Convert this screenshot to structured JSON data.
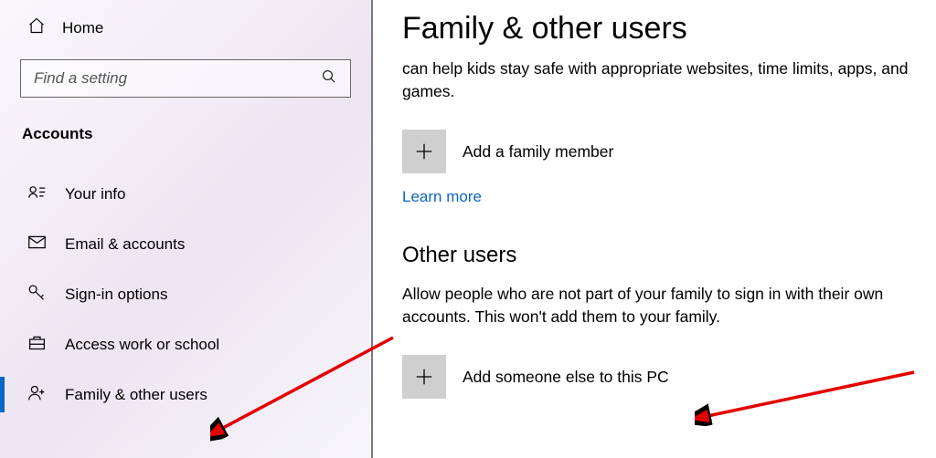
{
  "sidebar": {
    "home_label": "Home",
    "search_placeholder": "Find a setting",
    "section_label": "Accounts",
    "items": [
      {
        "label": "Your info"
      },
      {
        "label": "Email & accounts"
      },
      {
        "label": "Sign-in options"
      },
      {
        "label": "Access work or school"
      },
      {
        "label": "Family & other users"
      }
    ]
  },
  "main": {
    "page_title": "Family & other users",
    "family_desc": "can help kids stay safe with appropriate websites, time limits, apps, and games.",
    "add_family_label": "Add a family member",
    "learn_more": "Learn more",
    "other_header": "Other users",
    "other_desc": "Allow people who are not part of your family to sign in with their own accounts. This won't add them to your family.",
    "add_other_label": "Add someone else to this PC"
  }
}
